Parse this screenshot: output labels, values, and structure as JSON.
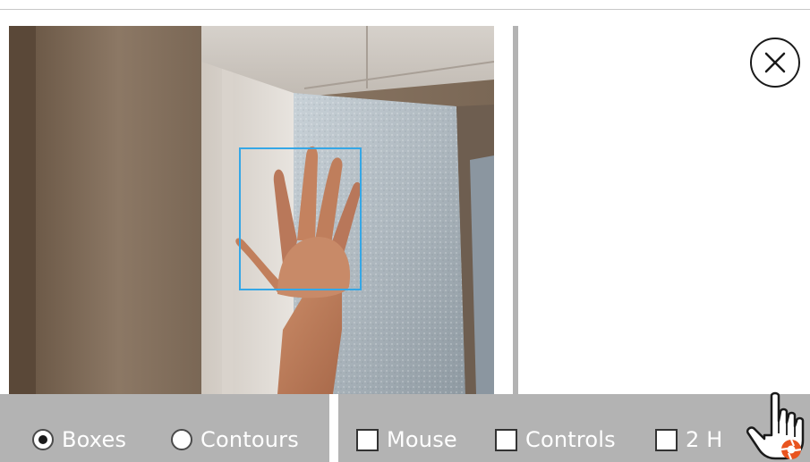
{
  "camera": {
    "detection_mode": "Boxes"
  },
  "close_button": {
    "icon": "close-icon"
  },
  "bottom_bar": {
    "modes": [
      {
        "label": "Boxes",
        "checked": true
      },
      {
        "label": "Contours",
        "checked": false
      }
    ],
    "options": [
      {
        "label": "Mouse",
        "checked": false
      },
      {
        "label": "Controls",
        "checked": false
      },
      {
        "label": "2 H",
        "checked": false
      }
    ]
  },
  "colors": {
    "detection_box": "#35a7e6",
    "bar_background": "#b3b3b3",
    "label_text": "#ffffff",
    "cursor_badge": "#e9541f"
  }
}
